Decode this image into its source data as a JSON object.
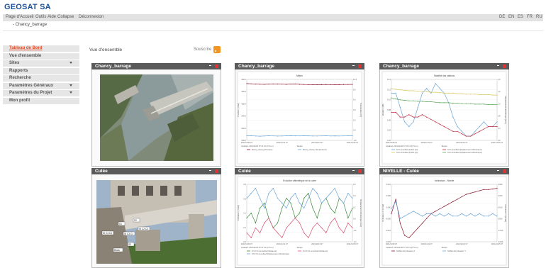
{
  "brand": {
    "name": "GEOSAT SA"
  },
  "menubar": {
    "items": [
      "Page d'Accueil",
      "Outils",
      "Aide",
      "Collapse",
      "Déconnexion"
    ],
    "languages": [
      "DE",
      "EN",
      "ES",
      "FR",
      "RU"
    ]
  },
  "breadcrumb": "- Chancy_barrage",
  "sidebar": {
    "items": [
      {
        "label": "Tableau de Bord",
        "active": true,
        "arrow": false
      },
      {
        "label": "Vue d'ensemble",
        "active": false,
        "arrow": false
      },
      {
        "label": "Sites",
        "active": false,
        "arrow": true
      },
      {
        "label": "Rapports",
        "active": false,
        "arrow": false
      },
      {
        "label": "Recherche",
        "active": false,
        "arrow": false
      },
      {
        "label": "Paramètres Généraux",
        "active": false,
        "arrow": true
      },
      {
        "label": "Paramètres du Projet",
        "active": false,
        "arrow": true
      },
      {
        "label": "Mon profil",
        "active": false,
        "arrow": false
      }
    ]
  },
  "main": {
    "overview_title": "Vue d'ensemble",
    "subscribe_label": "Souscrire"
  },
  "colors": {
    "active_nav": "#e34b2a",
    "brand": "#1b4f99",
    "widget_header": "#5a5a5a",
    "close": "#e03434",
    "rss": "#f39520"
  },
  "widgets": [
    {
      "title": "Chancy_barrage",
      "kind": "aerial-photo"
    },
    {
      "title": "Chancy_barrage",
      "kind": "chart",
      "chart_title": "Météo",
      "ylabel_left": "Pression [mbar]",
      "ylabel_right": "Température [C]",
      "xlabel": "Temps",
      "updated": "Updated: 2021/11/30 07:47:16 (UTC+1)",
      "x_ticks": [
        "2021/11/09 07",
        "2021/11/11 07",
        "2021/11/13 07",
        "2021/11/15 07"
      ],
      "y_ticks_left": [
        "960.0",
        "955.0",
        "950.0",
        "945.0",
        "940.0",
        "935.0"
      ],
      "y_ticks_right": [
        "10.0",
        "8.0",
        "6.0",
        "4.0",
        "2.0",
        "0.0",
        "-2.0"
      ],
      "legend": [
        "Meteo_chancy (Pression)",
        "Meteo_chancy (Température)"
      ]
    },
    {
      "title": "Chancy_barrage",
      "kind": "chart",
      "chart_title": "Stabilité des stations",
      "ylabel_left": "Variation [dB]",
      "ylabel_right": "Déplacement altimétrique [mm]",
      "xlabel": "Temps",
      "updated": "Updated: 2021/11/30 07:47:13 (UTC+1)",
      "x_ticks": [
        "2021/11/09 07",
        "2021/11/11 07",
        "2021/11/13 07",
        "2021/11/15 07"
      ],
      "y_ticks_left": [
        "0.14",
        "0.12",
        "0.10",
        "0.08",
        "0.06",
        "0.04",
        "0.02"
      ],
      "y_ticks_right": [
        "2.0",
        "1.6",
        "1.2",
        "0.8",
        "0.4",
        "0.0"
      ],
      "legend": [
        "ST1 smoothed (Indice Q2)",
        "ST1 smoothed (Déplacement Altimétrique)",
        "ST2 smoothed (Indice Q2)",
        "ST2 smoothed (Déplacement Altimétrique)"
      ]
    },
    {
      "title": "Culée",
      "kind": "bridge-photo",
      "labels": [
        "S1",
        "S2",
        "St C3 C4",
        "St C3 C1",
        "St C2 C3",
        "S3",
        "Block"
      ]
    },
    {
      "title": "Culée",
      "kind": "chart",
      "chart_title": "Evolution altimétrique de la culée",
      "ylabel_left": "Inclinaison [mrad]",
      "ylabel_right": "Déplacement altimétrique [mm]",
      "xlabel": "Temps",
      "updated": "Updated: 2021/11/30 07:47:13 (UTC+1)",
      "x_ticks": [
        "2021/11/09 07",
        "2021/11/11 07",
        "2021/11/13 07",
        "2021/11/15 07"
      ],
      "y_ticks_left": [
        "0.5",
        "0.3",
        "0.1",
        "-0.1",
        "-0.3"
      ],
      "y_ticks_right": [
        "0.6",
        "0.4",
        "0.2",
        "0.0",
        "-0.2",
        "-0.4"
      ],
      "legend": [
        "St C3 C4 smoothed (Distance)",
        "St C3 C1 smoothed (Distance)",
        "ST2 C3 smoothed (Déplacement Altimétrique)"
      ]
    },
    {
      "title": "NIVELLE - Culée",
      "kind": "chart",
      "chart_title": "Inclinaison - Nivelle",
      "ylabel_left": "Inclinaison X [mrad]",
      "ylabel_right": "Inclinaison Y [mrad]",
      "xlabel": "Temps",
      "updated": "Updated: 2021/11/30 07:47:13 (UTC+1)",
      "x_ticks": [
        "2021/11/09 07",
        "2021/11/11 07",
        "2021/11/13 07",
        "2021/11/15 07"
      ],
      "y_ticks_left": [
        "0.010",
        "0.005",
        "0.000",
        "-0.005",
        "-0.010",
        "-0.015"
      ],
      "y_ticks_right": [
        "0.030",
        "0.020",
        "0.010",
        "0.000",
        "-0.010",
        "-0.020"
      ],
      "legend": [
        "NIVELLE Inclinaison X",
        "NIVELLE Inclinaison Y"
      ]
    }
  ],
  "chart_data": [
    {
      "type": "line",
      "title": "Météo",
      "x": [
        0,
        1,
        2,
        3,
        4,
        5,
        6,
        7,
        8,
        9,
        10,
        11,
        12,
        13,
        14,
        15,
        16,
        17,
        18,
        19,
        20,
        21,
        22,
        23,
        24
      ],
      "series": [
        {
          "name": "Meteo_chancy (Pression)",
          "color": "#8b1a2f",
          "values": [
            958,
            955,
            950,
            947,
            945,
            949,
            953,
            951,
            948,
            946,
            950,
            952,
            946,
            942,
            940,
            938,
            937,
            939,
            941,
            940,
            938,
            939,
            941,
            942,
            944
          ]
        },
        {
          "name": "Meteo_chancy (Température)",
          "color": "#6aa6d8",
          "values": [
            7,
            6,
            2,
            -1,
            3,
            6,
            4,
            1,
            3,
            6,
            8,
            5,
            4,
            7,
            5,
            3,
            2,
            4,
            6,
            3,
            5,
            2,
            4,
            7,
            8
          ]
        }
      ]
    },
    {
      "type": "line",
      "title": "Stabilité des stations",
      "x": [
        0,
        1,
        2,
        3,
        4,
        5,
        6,
        7,
        8,
        9,
        10,
        11,
        12,
        13,
        14,
        15,
        16,
        17,
        18,
        19,
        20,
        21,
        22,
        23,
        24
      ],
      "series": [
        {
          "name": "ST1 smoothed (Indice Q2)",
          "color": "#6aa6d8",
          "values": [
            0.12,
            0.12,
            0.09,
            0.06,
            0.05,
            0.06,
            0.09,
            0.12,
            0.13,
            0.12,
            0.14,
            0.13,
            0.12,
            0.1,
            0.07,
            0.05,
            0.04,
            0.03,
            0.03,
            0.04,
            0.05,
            0.06,
            0.05,
            0.05,
            0.06
          ]
        },
        {
          "name": "ST1 smoothed (Déplacement Altimétrique)",
          "color": "#c03040",
          "values": [
            0.08,
            0.08,
            0.07,
            0.07,
            0.075,
            0.07,
            0.07,
            0.075,
            0.07,
            0.065,
            0.06,
            0.055,
            0.05,
            0.045,
            0.04,
            0.04,
            0.035,
            0.03,
            0.03,
            0.035,
            0.04,
            0.045,
            0.05,
            0.05,
            0.05
          ]
        },
        {
          "name": "ST2 smoothed (Indice Q2)",
          "color": "#d8c860",
          "values": [
            0.13,
            0.128,
            0.127,
            0.126,
            0.125,
            0.125,
            0.124,
            0.124,
            0.123,
            0.122,
            0.122,
            0.121,
            0.12,
            0.12,
            0.12,
            0.119,
            0.119,
            0.118,
            0.118,
            0.118,
            0.117,
            0.117,
            0.117,
            0.116,
            0.116
          ]
        },
        {
          "name": "ST2 smoothed (Déplacement Altimétrique)",
          "color": "#5fa85f",
          "values": [
            0.11,
            0.108,
            0.106,
            0.105,
            0.104,
            0.104,
            0.103,
            0.103,
            0.102,
            0.102,
            0.101,
            0.1,
            0.1,
            0.1,
            0.099,
            0.099,
            0.098,
            0.098,
            0.098,
            0.097,
            0.097,
            0.097,
            0.096,
            0.096,
            0.096
          ]
        }
      ]
    },
    {
      "type": "line",
      "title": "Evolution altimétrique de la culée",
      "x": [
        0,
        1,
        2,
        3,
        4,
        5,
        6,
        7,
        8,
        9,
        10,
        11,
        12,
        13,
        14,
        15,
        16,
        17,
        18,
        19,
        20,
        21,
        22,
        23,
        24
      ],
      "series": [
        {
          "name": "St C3 C4 smoothed (Distance)",
          "color": "#3a8a3a",
          "values": [
            0.1,
            0.15,
            0.05,
            0.2,
            0.25,
            0.1,
            0.0,
            0.05,
            0.2,
            0.3,
            0.25,
            0.1,
            0.15,
            0.3,
            0.35,
            0.2,
            0.1,
            0.25,
            0.3,
            0.2,
            0.15,
            0.3,
            0.25,
            0.1,
            0.2
          ]
        },
        {
          "name": "St C3 C1 smoothed (Distance)",
          "color": "#d85070",
          "values": [
            -0.05,
            -0.1,
            0.0,
            -0.05,
            0.05,
            0.1,
            0.0,
            -0.05,
            -0.1,
            0.0,
            0.05,
            0.1,
            0.05,
            -0.05,
            -0.1,
            0.0,
            0.05,
            0.0,
            -0.05,
            0.05,
            0.1,
            0.0,
            -0.05,
            0.05,
            0.0
          ]
        },
        {
          "name": "ST2 C3 smoothed (Déplacement Altimétrique)",
          "color": "#6aa6d8",
          "values": [
            0.3,
            0.35,
            0.4,
            0.3,
            0.2,
            0.35,
            0.4,
            0.3,
            0.25,
            0.2,
            0.3,
            0.35,
            0.25,
            0.2,
            0.3,
            0.4,
            0.35,
            0.25,
            0.3,
            0.35,
            0.4,
            0.3,
            0.25,
            0.35,
            0.3
          ]
        }
      ]
    },
    {
      "type": "line",
      "title": "Inclinaison - Nivelle",
      "x": [
        0,
        1,
        2,
        3,
        4,
        5,
        6,
        7,
        8,
        9,
        10,
        11,
        12,
        13,
        14,
        15,
        16,
        17,
        18,
        19,
        20,
        21,
        22,
        23,
        24
      ],
      "series": [
        {
          "name": "NIVELLE Inclinaison X",
          "color": "#8b1a2f",
          "values": [
            -0.002,
            0.004,
            -0.006,
            -0.011,
            -0.012,
            -0.01,
            -0.008,
            -0.006,
            -0.004,
            -0.002,
            -0.001,
            0.0,
            0.001,
            0.002,
            0.003,
            0.004,
            0.005,
            0.006,
            0.0065,
            0.007,
            0.0075,
            0.008,
            0.008,
            0.0082,
            0.0085
          ]
        },
        {
          "name": "NIVELLE Inclinaison Y",
          "color": "#6aa6d8",
          "values": [
            0.0,
            0.003,
            -0.004,
            -0.003,
            -0.002,
            -0.001,
            -0.002,
            -0.003,
            -0.002,
            -0.002,
            -0.003,
            -0.002,
            -0.003,
            -0.002,
            -0.003,
            -0.003,
            -0.002,
            -0.003,
            -0.002,
            -0.003,
            -0.002,
            -0.003,
            -0.003,
            -0.002,
            -0.003
          ]
        }
      ]
    }
  ]
}
